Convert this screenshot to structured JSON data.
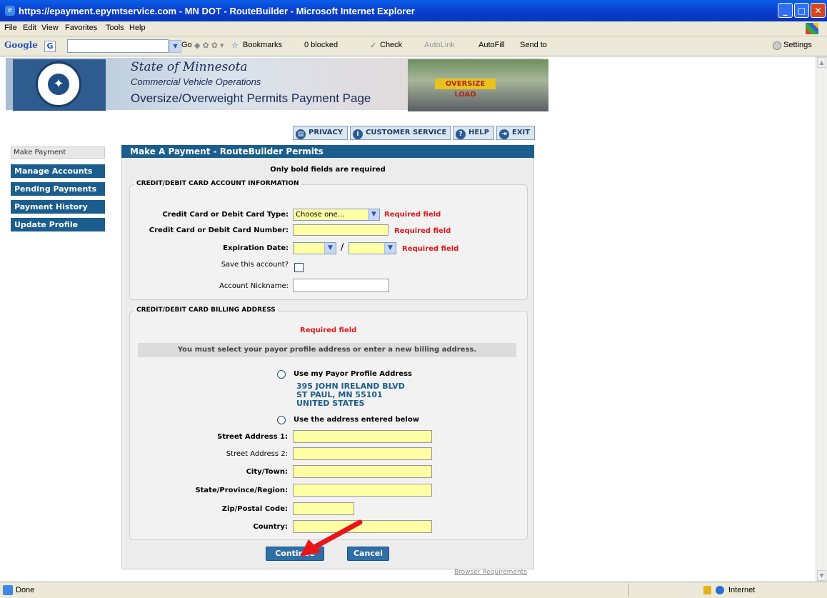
{
  "browser": {
    "title": "https://epayment.epymtservice.com - MN DOT - RouteBuilder - Microsoft Internet Explorer",
    "menu": [
      "File",
      "Edit",
      "View",
      "Favorites",
      "Tools",
      "Help"
    ],
    "toolbar": {
      "google_label": "Google",
      "go": "Go",
      "bookmarks": "Bookmarks",
      "blocked": "0 blocked",
      "check": "Check",
      "autolink": "AutoLink",
      "autofill": "AutoFill",
      "sendto": "Send to",
      "settings": "Settings"
    },
    "status": {
      "text": "Done",
      "zone": "Internet"
    }
  },
  "banner": {
    "state": "State of Minnesota",
    "division": "Commercial Vehicle Operations",
    "page_title": "Oversize/Overweight Permits Payment Page",
    "seal_text": "MINNESOTA DEPARTMENT OF TRANSPORTATION",
    "truck_sign": "OVERSIZE LOAD"
  },
  "topnav": {
    "privacy": "PRIVACY",
    "customer_service": "CUSTOMER SERVICE",
    "help": "HELP",
    "exit": "EXIT"
  },
  "leftnav": [
    "Make Payment",
    "Manage Accounts",
    "Pending Payments",
    "Payment History",
    "Update Profile"
  ],
  "form": {
    "header": "Make A Payment - RouteBuilder Permits",
    "required_note": "Only bold fields are required",
    "card_section": {
      "legend": "CREDIT/DEBIT CARD ACCOUNT INFORMATION",
      "card_type_label": "Credit Card or Debit Card Type:",
      "card_type_value": "Choose one...",
      "card_number_label": "Credit Card or Debit Card Number:",
      "expiration_label": "Expiration Date:",
      "slash": "/",
      "save_label": "Save this account?",
      "nickname_label": "Account Nickname:",
      "required": "Required field"
    },
    "billing_section": {
      "legend": "CREDIT/DEBIT CARD BILLING ADDRESS",
      "required": "Required field",
      "instruction": "You must select your payor profile address or enter a new billing address.",
      "use_profile": "Use my Payor Profile Address",
      "address_lines": [
        "395 JOHN IRELAND BLVD",
        "ST PAUL, MN  55101",
        "UNITED STATES"
      ],
      "use_entered": "Use the address entered below",
      "street1": "Street Address 1:",
      "street2": "Street Address 2:",
      "city": "City/Town:",
      "state": "State/Province/Region:",
      "zip": "Zip/Postal Code:",
      "country": "Country:"
    },
    "continue": "Continue",
    "cancel": "Cancel",
    "browser_req": "Browser Requirements"
  },
  "colors": {
    "accent": "#1b5d8c",
    "required": "#e0171b",
    "field": "#ffffa6",
    "annotation_arrow": "#e8161b"
  }
}
